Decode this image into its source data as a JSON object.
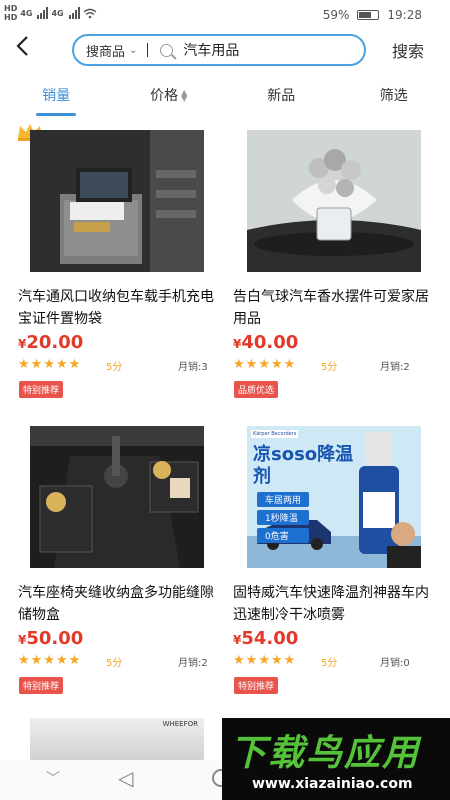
{
  "status": {
    "left_a": "HD",
    "left_b": "4G",
    "battery": "59%",
    "time": "19:28"
  },
  "header": {
    "scope_label": "搜商品",
    "query": "汽车用品",
    "search_button": "搜索"
  },
  "tabs": [
    {
      "label": "销量"
    },
    {
      "label": "价格"
    },
    {
      "label": "新品"
    },
    {
      "label": "筛选"
    }
  ],
  "products": [
    {
      "title": "汽车通风口收纳包车载手机充电宝证件置物袋",
      "currency": "¥",
      "price": "20.00",
      "score": "5分",
      "sales": "月销:3",
      "badge": "特别推荐"
    },
    {
      "title": "告白气球汽车香水摆件可爱家居用品",
      "currency": "¥",
      "price": "40.00",
      "score": "5分",
      "sales": "月销:2",
      "badge": "品质优选"
    },
    {
      "title": "汽车座椅夹缝收纳盒多功能缝隙储物盒",
      "currency": "¥",
      "price": "50.00",
      "score": "5分",
      "sales": "月销:2",
      "badge": "特别推荐"
    },
    {
      "title": "固特威汽车快速降温剂神器车内迅速制冷干冰喷雾",
      "currency": "¥",
      "price": "54.00",
      "score": "5分",
      "sales": "月销:0",
      "badge": "特别推荐"
    }
  ],
  "product_images": {
    "p4_brand": "Kärper Becorders",
    "p4_title": "凉soso降温剂",
    "p4_lines": [
      "车居两用",
      "1秒降温",
      "0危害"
    ]
  },
  "partial_label": "WHEEFOR",
  "watermark": {
    "big": "下载鸟应用",
    "url": "www.xiazainiao.com"
  },
  "colors": {
    "accent": "#3b8ed8",
    "price": "#e23a2a",
    "star": "#f5a623",
    "badge": "#e8544c"
  }
}
